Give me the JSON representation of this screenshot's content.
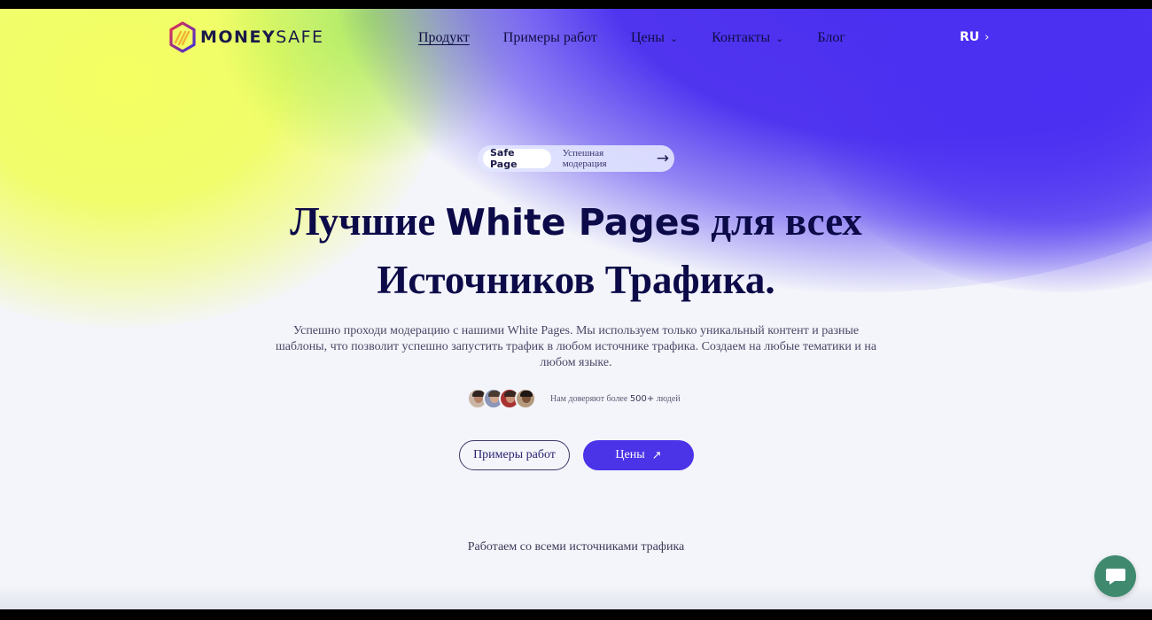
{
  "brand": {
    "name_part1": "MONEY",
    "name_part2": "SAFE"
  },
  "nav": {
    "items": [
      {
        "label": "Продукт",
        "has_dropdown": false,
        "active": true
      },
      {
        "label": "Примеры работ",
        "has_dropdown": false
      },
      {
        "label": "Цены",
        "has_dropdown": true
      },
      {
        "label": "Контакты",
        "has_dropdown": true
      },
      {
        "label": "Блог",
        "has_dropdown": false
      }
    ],
    "language": "RU"
  },
  "hero": {
    "pill": {
      "tag": "Safe Page",
      "text": "Успешная модерация"
    },
    "headline": {
      "line1_a": "Лучшие ",
      "line1_b": "White Pages",
      "line1_c": " для всех",
      "line2": "Источников Трафика."
    },
    "subtext": "Успешно проходи модерацию с нашими White Pages. Мы используем только уникальный контент и разные шаблоны, что позволит успешно запустить трафик в любом источнике трафика. Создаем на любые тематики и на любом языке.",
    "trust": {
      "prefix": "Нам доверяют более ",
      "count": "500+",
      "suffix": " людей"
    },
    "buttons": {
      "secondary": "Примеры работ",
      "primary": "Цены"
    }
  },
  "sources_caption": "Работаем со всеми источниками трафика",
  "colors": {
    "accent": "#4b33e8",
    "headline": "#0c0a48",
    "chat_button": "#3f8a6f"
  },
  "icons": {
    "logo": "shield-logo-icon",
    "pill_arrow": "arrow-right-icon",
    "cta_arrow": "arrow-up-right-icon",
    "chat": "chat-bubble-icon",
    "dropdown": "chevron-down-icon",
    "language": "chevron-right-icon"
  }
}
